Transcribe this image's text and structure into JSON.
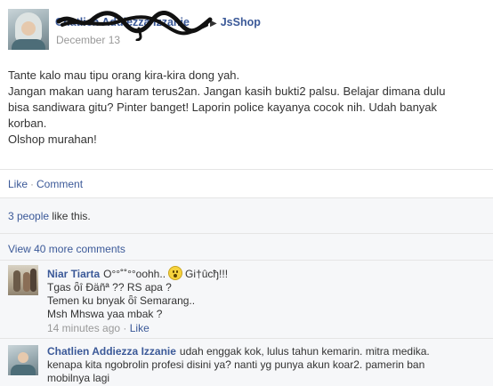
{
  "post": {
    "author_name": "Chatlien Addiezza Izzanie",
    "separator_icon": "triangle-right-icon",
    "target_page": "JsShop",
    "date": "December 13",
    "body_lines": [
      "Tante kalo mau tipu orang kira-kira dong yah.",
      "Jangan makan uang haram terus2an. Jangan kasih bukti2 palsu. Belajar dimana dulu",
      "bisa sandiwara gitu? Pinter banget! Laporin police kayanya cocok nih. Udah banyak",
      "korban.",
      "Olshop murahan!"
    ],
    "actions": {
      "like": "Like",
      "separator": "·",
      "comment": "Comment"
    }
  },
  "feedback": {
    "likes_count_link": "3 people",
    "likes_suffix": " like this.",
    "view_more": "View 40 more comments"
  },
  "comments": [
    {
      "author": "Niar Tiarta",
      "first_line_a": "O°°˚˚°°oohh..",
      "emoji": "gasp-emoticon-icon",
      "first_line_b": "Gi†ûcђ!!!",
      "lines": [
        "Tgas ȫî Ɖäñª ?? RS apa ?",
        "Temen ku bnyak ȫî Semarang..",
        "Msh Mhswa yaa mbak ?"
      ],
      "time": "14 minutes ago",
      "meta_separator": "·",
      "like_label": "Like"
    },
    {
      "author": "Chatlien Addiezza Izzanie",
      "first_line": "udah enggak kok, lulus tahun kemarin. mitra medika.",
      "lines": [
        "kenapa kita ngobrolin profesi disini ya? nanti yg punya akun koar2. pamerin ban",
        "mobilnya lagi"
      ]
    }
  ],
  "colors": {
    "link_blue": "#3b5998",
    "text": "#333333",
    "muted": "#999999",
    "feedback_bg": "#f6f7f9",
    "divider": "#e5e5e5"
  }
}
